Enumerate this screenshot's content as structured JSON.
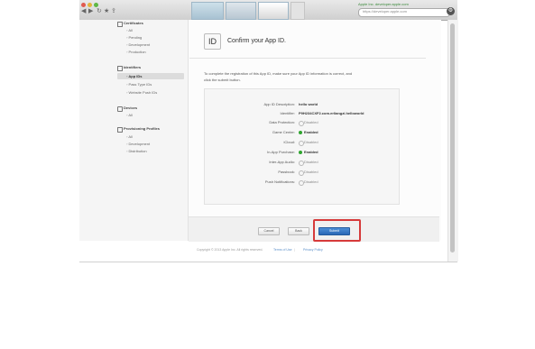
{
  "browser": {
    "secure_label": "Apple Inc. developer.apple.com",
    "address_text": "https://developer.apple.com"
  },
  "sidebar": {
    "certificates": {
      "title": "Certificates",
      "items": [
        "All",
        "Pending",
        "Development",
        "Production"
      ]
    },
    "identifiers": {
      "title": "Identifiers",
      "items": [
        "App IDs",
        "Pass Type IDs",
        "Website Push IDs"
      ]
    },
    "devices": {
      "title": "Devices",
      "items": [
        "All"
      ]
    },
    "profiles": {
      "title": "Provisioning Profiles",
      "items": [
        "All",
        "Development",
        "Distribution"
      ]
    }
  },
  "main": {
    "icon_text": "ID",
    "heading": "Confirm your App ID.",
    "description_line1": "To complete the registration of this App ID, make sure your App ID information is correct, and",
    "description_line2": "click the submit button.",
    "rows": [
      {
        "label": "App ID Description:",
        "value": "hello world"
      },
      {
        "label": "Identifier:",
        "value": "P9H234CXF2.com.erliangzi.helloworld"
      },
      {
        "label": "Data Protection:",
        "value": "Disabled",
        "status": "disabled"
      },
      {
        "label": "Game Center:",
        "value": "Enabled",
        "status": "enabled"
      },
      {
        "label": "iCloud:",
        "value": "Disabled",
        "status": "disabled"
      },
      {
        "label": "In-App Purchase:",
        "value": "Enabled",
        "status": "enabled"
      },
      {
        "label": "Inter-App Audio:",
        "value": "Disabled",
        "status": "disabled"
      },
      {
        "label": "Passbook:",
        "value": "Disabled",
        "status": "disabled"
      },
      {
        "label": "Push Notifications:",
        "value": "Disabled",
        "status": "disabled"
      }
    ],
    "buttons": {
      "cancel": "Cancel",
      "back": "Back",
      "submit": "Submit"
    }
  },
  "footer": {
    "copyright": "Copyright © 2013 Apple Inc. All rights reserved.",
    "terms": "Terms of Use",
    "privacy": "Privacy Policy"
  },
  "colors": {
    "enabled": "#2fa52f",
    "disabled": "#b9b9b9",
    "submit_highlight": "#d63a3a",
    "submit_button": "#2a67b6"
  }
}
